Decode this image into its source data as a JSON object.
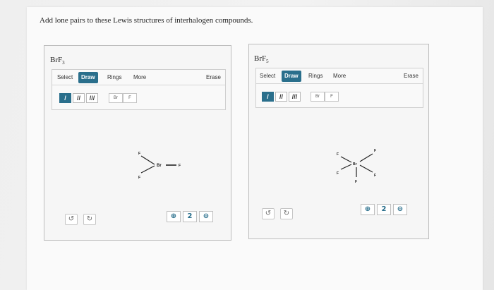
{
  "question": "Add lone pairs to these Lewis structures of interhalogen compounds.",
  "panels": [
    {
      "title_main": "BrF",
      "title_sub": "3",
      "tabs": [
        "Select",
        "Draw",
        "Rings",
        "More"
      ],
      "active_tab": "Draw",
      "erase": "Erase",
      "bonds": [
        "/",
        "//",
        "///"
      ],
      "atoms": [
        "Br",
        "F"
      ],
      "molecule": {
        "center": "Br",
        "ligands": [
          "F",
          "F",
          "F"
        ]
      },
      "undo": "↺",
      "redo": "↻",
      "zoom": [
        "⊕",
        "2",
        "⊖"
      ]
    },
    {
      "title_main": "BrF",
      "title_sub": "5",
      "tabs": [
        "Select",
        "Draw",
        "Rings",
        "More"
      ],
      "active_tab": "Draw",
      "erase": "Erase",
      "bonds": [
        "/",
        "//",
        "///"
      ],
      "atoms": [
        "Br",
        "F"
      ],
      "molecule": {
        "center": "Br",
        "ligands": [
          "F",
          "F",
          "F",
          "F",
          "F"
        ]
      },
      "undo": "↺",
      "redo": "↻",
      "zoom": [
        "⊕",
        "2",
        "⊖"
      ]
    }
  ],
  "colors": {
    "accent": "#2a6f8c",
    "border": "#bdbdbd"
  }
}
